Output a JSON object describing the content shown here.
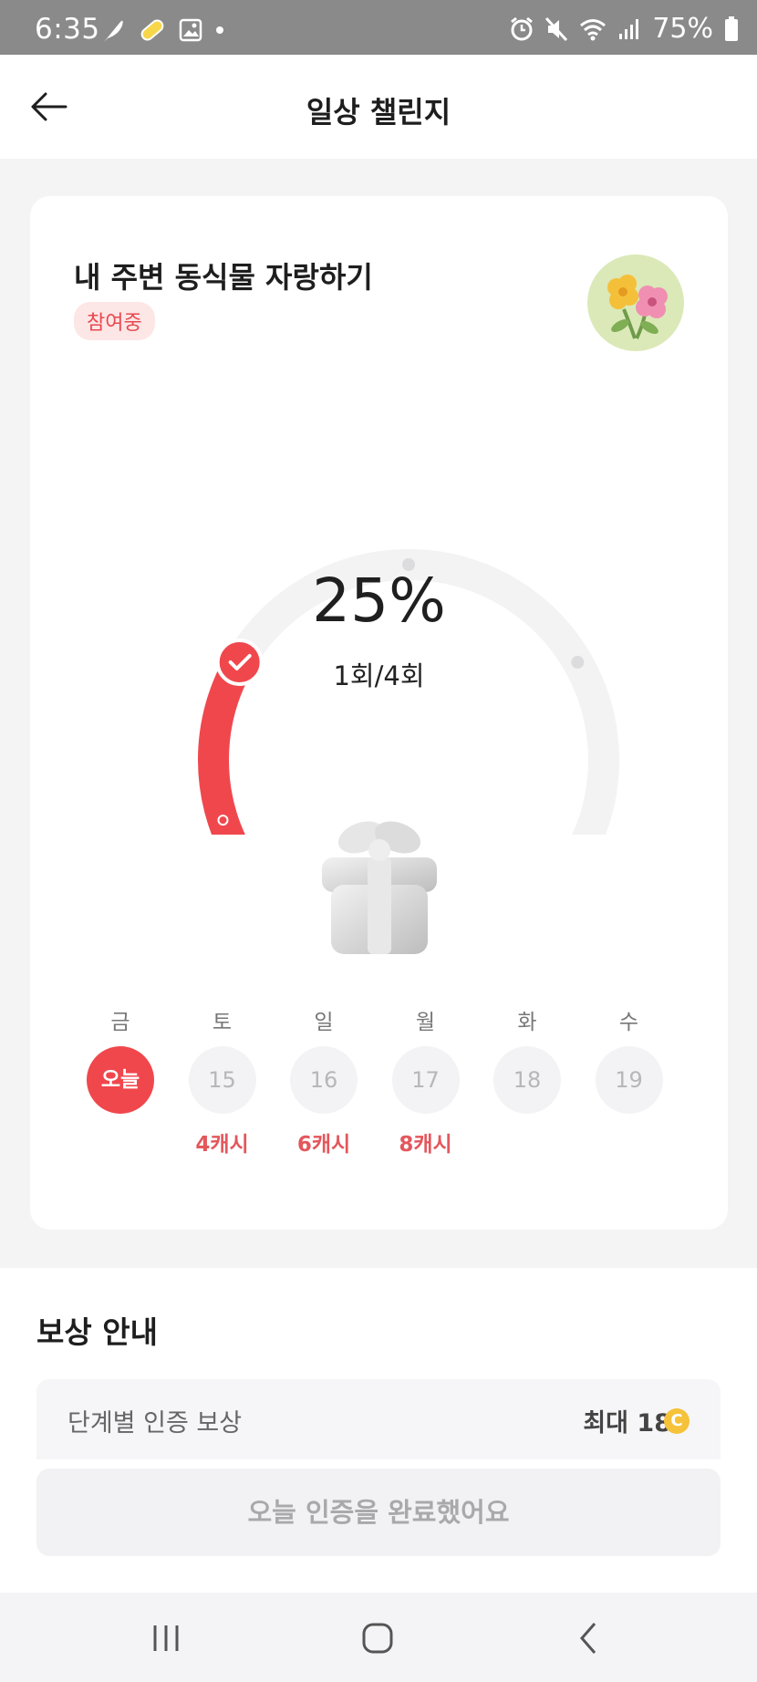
{
  "status_bar": {
    "time": "6:35",
    "battery": "75%",
    "left_icons": [
      "feather-icon",
      "capsule-icon",
      "image-icon",
      "dot-icon"
    ],
    "right_icons": [
      "alarm-icon",
      "mute-icon",
      "wifi-icon",
      "signal-icon",
      "battery-icon"
    ]
  },
  "header": {
    "title": "일상 챌린지"
  },
  "challenge": {
    "title": "내 주변 동식물 자랑하기",
    "status": "참여중",
    "progress_percent_label": "25%",
    "progress_fraction": 0.25,
    "count_label": "1회/4회",
    "accent_color": "#f0474d"
  },
  "days": [
    {
      "name": "금",
      "date": "오늘",
      "reward": "",
      "today": true
    },
    {
      "name": "토",
      "date": "15",
      "reward": "4캐시",
      "today": false
    },
    {
      "name": "일",
      "date": "16",
      "reward": "6캐시",
      "today": false
    },
    {
      "name": "월",
      "date": "17",
      "reward": "8캐시",
      "today": false
    },
    {
      "name": "화",
      "date": "18",
      "reward": "",
      "today": false
    },
    {
      "name": "수",
      "date": "19",
      "reward": "",
      "today": false
    }
  ],
  "reward": {
    "heading": "보상 안내",
    "row_label": "단계별 인증 보상",
    "row_value": "최대 18",
    "coin_symbol": "C",
    "button_label": "오늘 인증을 완료했어요"
  }
}
